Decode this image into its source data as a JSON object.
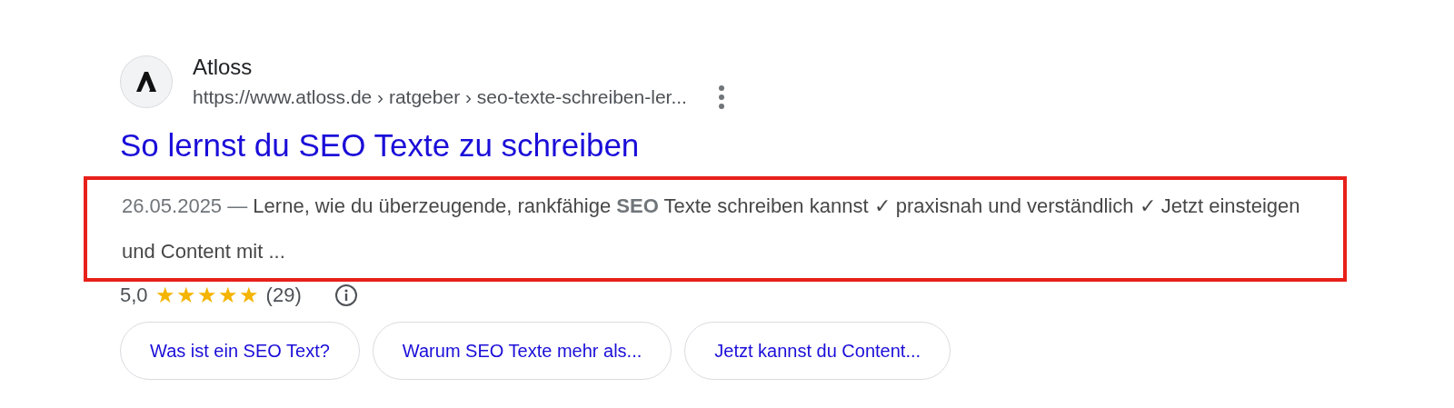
{
  "result": {
    "site_name": "Atloss",
    "url": "https://www.atloss.de › ratgeber › seo-texte-schreiben-ler...",
    "title": "So lernst du SEO Texte zu schreiben",
    "snippet": {
      "highlighted": true,
      "date": "26.05.2025 —",
      "text": "Lerne, wie du überzeugende, rankfähige **SEO** Texte schreiben kannst ✓ praxisnah und verständlich ✓ Jetzt einsteigen und Content mit ..."
    },
    "rating": {
      "score": "5,0",
      "stars": 5,
      "count": "(29)"
    },
    "chips": [
      "Was ist ein SEO Text?",
      "Warum SEO Texte mehr als...",
      "Jetzt kannst du Content..."
    ]
  }
}
